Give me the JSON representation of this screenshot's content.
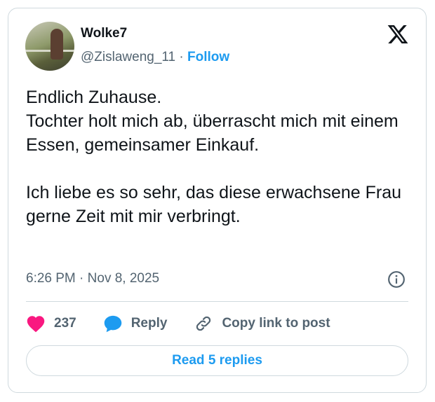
{
  "author": {
    "name": "Wolke7",
    "handle": "@Zislaweng_11",
    "separator": "·",
    "follow_label": "Follow"
  },
  "post": {
    "text": "Endlich Zuhause.\nTochter holt mich ab, überrascht mich mit einem Essen, gemeinsamer Einkauf.\n\nIch liebe es so sehr, das diese erwachsene Frau gerne Zeit mit mir verbringt.",
    "time": "6:26 PM",
    "date_separator": "·",
    "date": "Nov 8, 2025"
  },
  "actions": {
    "like_count": "237",
    "reply_label": "Reply",
    "copy_label": "Copy link to post"
  },
  "read_replies_label": "Read 5 replies",
  "icons": {
    "brand": "x-logo-icon",
    "info": "info-icon",
    "like": "heart-icon",
    "reply": "speech-bubble-icon",
    "copy": "link-icon"
  },
  "colors": {
    "accent": "#1d9bf0",
    "like": "#f91880",
    "text": "#0f1419",
    "muted": "#536471"
  }
}
